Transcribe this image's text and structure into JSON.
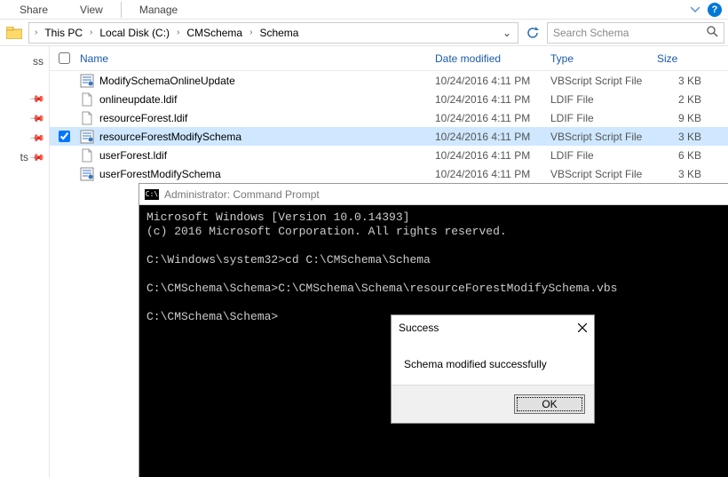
{
  "ribbon": {
    "tabs": [
      "Share",
      "View",
      "Manage"
    ]
  },
  "breadcrumb": {
    "items": [
      "This PC",
      "Local Disk (C:)",
      "CMSchema",
      "Schema"
    ]
  },
  "search": {
    "placeholder": "Search Schema"
  },
  "columns": {
    "name": "Name",
    "date": "Date modified",
    "type": "Type",
    "size": "Size"
  },
  "files": [
    {
      "selected": false,
      "checked": false,
      "icon": "vbs",
      "name": "ModifySchemaOnlineUpdate",
      "date": "10/24/2016 4:11 PM",
      "type": "VBScript Script File",
      "size": "3 KB"
    },
    {
      "selected": false,
      "checked": false,
      "icon": "ldif",
      "name": "onlineupdate.ldif",
      "date": "10/24/2016 4:11 PM",
      "type": "LDIF File",
      "size": "2 KB"
    },
    {
      "selected": false,
      "checked": false,
      "icon": "ldif",
      "name": "resourceForest.ldif",
      "date": "10/24/2016 4:11 PM",
      "type": "LDIF File",
      "size": "9 KB"
    },
    {
      "selected": true,
      "checked": true,
      "icon": "vbs",
      "name": "resourceForestModifySchema",
      "date": "10/24/2016 4:11 PM",
      "type": "VBScript Script File",
      "size": "3 KB"
    },
    {
      "selected": false,
      "checked": false,
      "icon": "ldif",
      "name": "userForest.ldif",
      "date": "10/24/2016 4:11 PM",
      "type": "LDIF File",
      "size": "6 KB"
    },
    {
      "selected": false,
      "checked": false,
      "icon": "vbs",
      "name": "userForestModifySchema",
      "date": "10/24/2016 4:11 PM",
      "type": "VBScript Script File",
      "size": "3 KB"
    }
  ],
  "nav_items": [
    "ss",
    "",
    "",
    "ts",
    ""
  ],
  "cmd": {
    "title": "Administrator: Command Prompt",
    "lines": [
      "Microsoft Windows [Version 10.0.14393]",
      "(c) 2016 Microsoft Corporation. All rights reserved.",
      "",
      "C:\\Windows\\system32>cd C:\\CMSchema\\Schema",
      "",
      "C:\\CMSchema\\Schema>C:\\CMSchema\\Schema\\resourceForestModifySchema.vbs",
      "",
      "C:\\CMSchema\\Schema>"
    ]
  },
  "msgbox": {
    "title": "Success",
    "body": "Schema modified successfully",
    "ok": "OK"
  }
}
